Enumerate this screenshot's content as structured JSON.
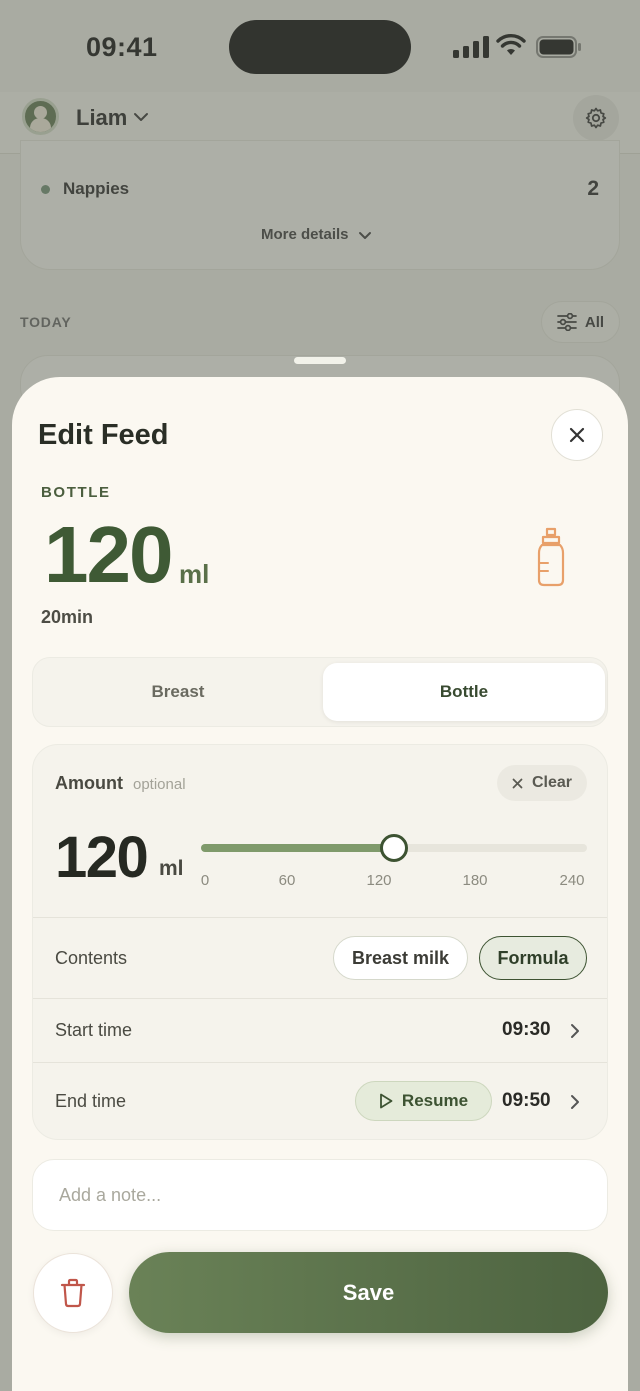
{
  "status_bar": {
    "time": "09:41"
  },
  "header": {
    "user_name": "Liam"
  },
  "summary": {
    "nappies_label": "Nappies",
    "nappies_count": "2",
    "more_details": "More details"
  },
  "feed_list": {
    "section_label": "TODAY",
    "filter_label": "All"
  },
  "sheet": {
    "title": "Edit Feed",
    "type_label": "BOTTLE",
    "amount": "120",
    "unit": "ml",
    "duration": "20min",
    "segments": {
      "breast": "Breast",
      "bottle": "Bottle",
      "selected": "Bottle"
    },
    "amount_section": {
      "label": "Amount",
      "optional": "optional",
      "clear_label": "Clear",
      "value": "120",
      "unit": "ml",
      "slider_value": 120,
      "slider_min": 0,
      "slider_max": 240,
      "ticks": [
        "0",
        "60",
        "120",
        "180",
        "240"
      ]
    },
    "contents": {
      "label": "Contents",
      "options": [
        "Breast milk",
        "Formula"
      ],
      "selected": "Formula"
    },
    "start_time": {
      "label": "Start time",
      "value": "09:30"
    },
    "end_time": {
      "label": "End time",
      "resume_label": "Resume",
      "value": "09:50"
    },
    "note": {
      "placeholder": "Add a note...",
      "value": ""
    },
    "save_label": "Save"
  },
  "colors": {
    "accent": "#4d6340",
    "accent_light": "#7f9a6b",
    "bottle_icon": "#e8a06a",
    "delete_icon": "#c0564a"
  }
}
